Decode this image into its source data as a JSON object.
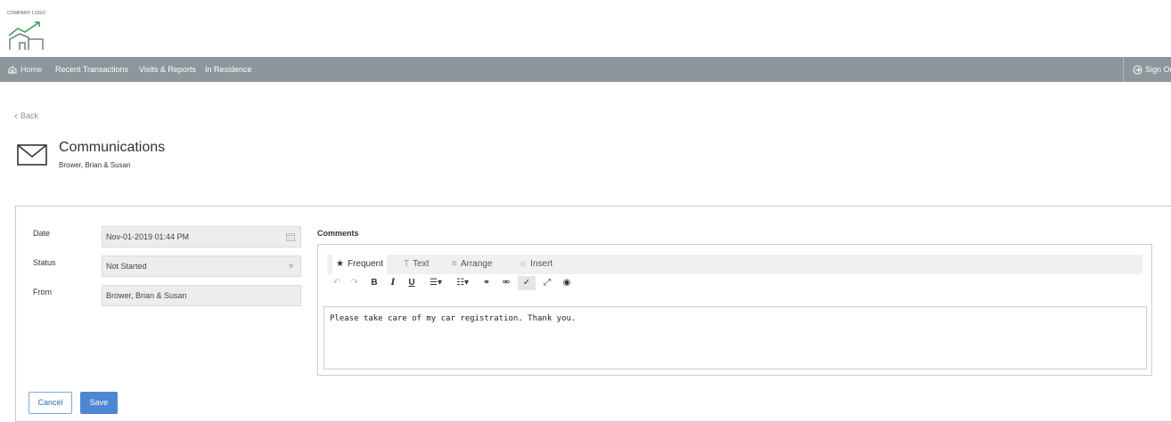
{
  "logo": {
    "text": "COMPANY LOGO",
    "icon": "house-chart-logo"
  },
  "nav": {
    "items": [
      {
        "label": "Home",
        "icon": "home-icon"
      },
      {
        "label": "Recent Transactions"
      },
      {
        "label": "Visits & Reports"
      },
      {
        "label": "In Residence"
      }
    ],
    "signout": {
      "label": "Sign Out",
      "icon": "signout-icon"
    }
  },
  "back": {
    "label": "Back"
  },
  "page": {
    "title": "Communications",
    "subtitle": "Brower, Brian & Susan",
    "icon": "envelope-icon"
  },
  "form": {
    "date": {
      "label": "Date",
      "value": "Nov-01-2019 01:44 PM",
      "icon": "calendar-icon"
    },
    "status": {
      "label": "Status",
      "value": "Not Started",
      "icon": "dropdown-arrow-icon"
    },
    "from": {
      "label": "From",
      "value": "Brower, Brian & Susan"
    }
  },
  "comments": {
    "label": "Comments",
    "tabs": [
      {
        "label": "Frequent",
        "icon": "star-icon"
      },
      {
        "label": "Text",
        "icon": "text-icon"
      },
      {
        "label": "Arrange",
        "icon": "align-icon"
      },
      {
        "label": "Insert",
        "icon": "lightbulb-icon"
      }
    ],
    "text": "Please take care of my car registration.  Thank you."
  },
  "buttons": {
    "cancel": "Cancel",
    "save": "Save"
  },
  "colors": {
    "navbar": "#8c979c",
    "primary": "#4f86d1",
    "logo_green": "#3a9b5a"
  }
}
